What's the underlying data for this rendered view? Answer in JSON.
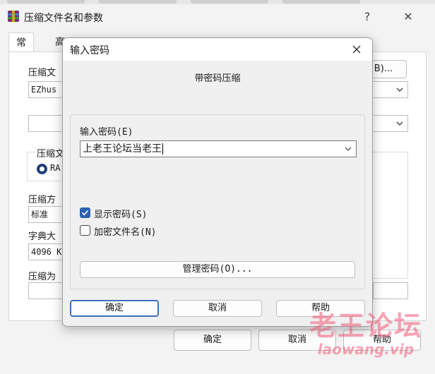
{
  "parent": {
    "title": "压缩文件名和参数",
    "help_glyph": "?",
    "close_glyph": "✕",
    "tabs": [
      "常规",
      "高"
    ],
    "archive_name_label": "压缩文",
    "archive_name_value": "EZhus",
    "browse_button": "B)...",
    "format_label": "压缩文",
    "format_radio": "RA",
    "method_label": "压缩方",
    "method_value": "标准",
    "dict_label": "字典大",
    "dict_value": "4096 K",
    "split_label": "压缩为",
    "ok_button": "确定",
    "cancel_button": "取消",
    "help_button": "帮助"
  },
  "modal": {
    "title": "输入密码",
    "close_glyph": "✕",
    "heading": "带密码压缩",
    "password_label": "输入密码(E)",
    "password_value": "上老王论坛当老王",
    "show_password_label": "显示密码(S)",
    "show_password_checked": true,
    "encrypt_filenames_label": "加密文件名(N)",
    "encrypt_filenames_checked": false,
    "manage_button": "管理密码(O)...",
    "ok_button": "确定",
    "cancel_button": "取消",
    "help_button": "帮助"
  },
  "watermark": {
    "main": "老王论坛",
    "sub": "laowang.vip"
  },
  "colors": {
    "accent": "#2f62ad",
    "watermark": "#f05a78"
  }
}
